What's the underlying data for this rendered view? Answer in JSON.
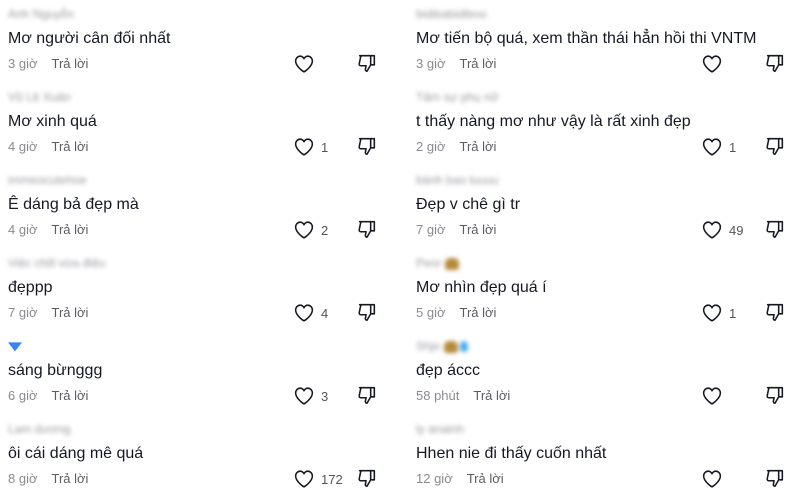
{
  "comments_left": [
    {
      "user": "Anh Nguyễn",
      "text": "Mơ người cân đối nhất",
      "time": "3 giờ",
      "reply": "Trả lời",
      "likes": ""
    },
    {
      "user": "Vũ Lệ Xuân",
      "text": "Mơ xinh quá",
      "time": "4 giờ",
      "reply": "Trả lời",
      "likes": "1"
    },
    {
      "user": "immeocutehoe",
      "text": "Ê dáng bả đẹp mà",
      "time": "4 giờ",
      "reply": "Trả lời",
      "likes": "2"
    },
    {
      "user": "Việc chill vừa điệu",
      "text": "đẹppp",
      "time": "7 giờ",
      "reply": "Trả lời",
      "likes": "4"
    },
    {
      "user": "",
      "text": "sáng bừnggg",
      "time": "6 giờ",
      "reply": "Trả lời",
      "likes": "3"
    },
    {
      "user": "Lam dương",
      "text": "ôi cái dáng mê quá",
      "time": "8 giờ",
      "reply": "Trả lời",
      "likes": "172"
    }
  ],
  "comments_right": [
    {
      "user": "bidibabidiboo",
      "text": "Mơ tiến bộ quá, xem thần thái hẳn hồi thi VNTM",
      "time": "3 giờ",
      "reply": "Trả lời",
      "likes": ""
    },
    {
      "user": "Tâm sự phụ nữ",
      "text": "t thấy nàng mơ như vậy là rất xinh đẹp",
      "time": "2 giờ",
      "reply": "Trả lời",
      "likes": "1"
    },
    {
      "user": "bánh bao luuuu",
      "text": "Đẹp v chê gì tr",
      "time": "7 giờ",
      "reply": "Trả lời",
      "likes": "49"
    },
    {
      "user": "Peor",
      "text": "Mơ nhìn đẹp quá í",
      "time": "5 giờ",
      "reply": "Trả lời",
      "likes": "1"
    },
    {
      "user": "Shje",
      "text": "đẹp áccc",
      "time": "58 phút",
      "reply": "Trả lời",
      "likes": ""
    },
    {
      "user": "ly anainh",
      "text": "Hhen nie đi thấy cuốn nhất",
      "time": "12 giờ",
      "reply": "Trả lời",
      "likes": ""
    }
  ],
  "icons": {
    "like": "heart-outline-icon",
    "dislike": "thumbs-down-icon"
  },
  "colors": {
    "text": "#161823",
    "meta": "#8a8b91",
    "icon": "#161823"
  }
}
